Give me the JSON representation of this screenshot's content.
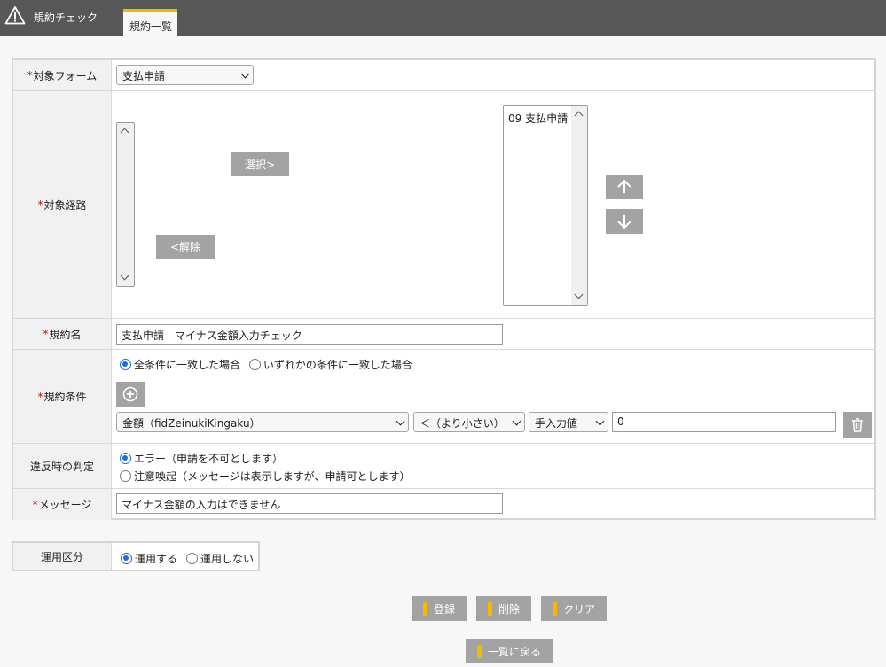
{
  "header": {
    "title": "規約チェック",
    "tab_label": "規約一覧"
  },
  "form": {
    "target_form": {
      "label": "対象フォーム",
      "value": "支払申請"
    },
    "target_route": {
      "label": "対象経路",
      "select_label": "選択>",
      "remove_label": "<解除",
      "selected_items": [
        "09 支払申請"
      ]
    },
    "rule_name": {
      "label": "規約名",
      "value": "支払申請　マイナス金額入力チェック"
    },
    "rule_condition": {
      "label": "規約条件",
      "match_all": "全条件に一致した場合",
      "match_any": "いずれかの条件に一致した場合",
      "field": "金額（fidZeinukiKingaku）",
      "operator": "＜（より小さい）",
      "value_type": "手入力値",
      "value": "0"
    },
    "violation": {
      "label": "違反時の判定",
      "error_option": "エラー（申請を不可とします）",
      "warn_option": "注意喚起（メッセージは表示しますが、申請可とします）"
    },
    "message": {
      "label": "メッセージ",
      "value": "マイナス金額の入力はできません"
    }
  },
  "apply": {
    "label": "運用区分",
    "on": "運用する",
    "off": "運用しない"
  },
  "actions": {
    "register": "登録",
    "delete": "削除",
    "clear": "クリア",
    "back": "一覧に戻る"
  },
  "colors": {
    "accent": "#f5b800",
    "header_bg": "#575757",
    "radio": "#1a6fd6",
    "required": "#d60000"
  }
}
